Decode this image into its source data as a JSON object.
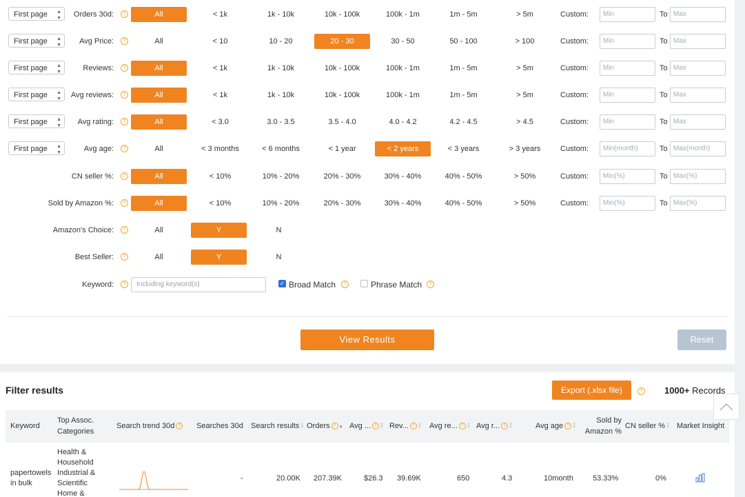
{
  "filters": {
    "select_label": "First page",
    "custom_label": "Custom:",
    "to_label": "To",
    "rows": [
      {
        "label": "Orders 30d:",
        "has_select": true,
        "options": [
          "All",
          "< 1k",
          "1k - 10k",
          "10k - 100k",
          "100k - 1m",
          "1m - 5m",
          "> 5m"
        ],
        "selected": 0,
        "min_placeholder": "Min",
        "max_placeholder": "Max"
      },
      {
        "label": "Avg Price:",
        "has_select": true,
        "options": [
          "All",
          "< 10",
          "10 - 20",
          "20 - 30",
          "30 - 50",
          "50 - 100",
          "> 100"
        ],
        "selected": 3,
        "min_placeholder": "Min",
        "max_placeholder": "Max"
      },
      {
        "label": "Reviews:",
        "has_select": true,
        "options": [
          "All",
          "< 1k",
          "1k - 10k",
          "10k - 100k",
          "100k - 1m",
          "1m - 5m",
          "> 5m"
        ],
        "selected": 0,
        "min_placeholder": "Min",
        "max_placeholder": "Max"
      },
      {
        "label": "Avg reviews:",
        "has_select": true,
        "options": [
          "All",
          "< 1k",
          "1k - 10k",
          "10k - 100k",
          "100k - 1m",
          "1m - 5m",
          "> 5m"
        ],
        "selected": 0,
        "min_placeholder": "Min",
        "max_placeholder": "Max"
      },
      {
        "label": "Avg rating:",
        "has_select": true,
        "options": [
          "All",
          "< 3.0",
          "3.0 - 3.5",
          "3.5 - 4.0",
          "4.0 - 4.2",
          "4.2 - 4.5",
          "> 4.5"
        ],
        "selected": 0,
        "min_placeholder": "Min",
        "max_placeholder": "Max"
      },
      {
        "label": "Avg age:",
        "has_select": true,
        "options": [
          "All",
          "< 3 months",
          "< 6 months",
          "< 1 year",
          "< 2 years",
          "< 3 years",
          "> 3 years"
        ],
        "selected": 4,
        "min_placeholder": "Min(month)",
        "max_placeholder": "Max(month)"
      },
      {
        "label": "CN seller %:",
        "has_select": false,
        "options": [
          "All",
          "< 10%",
          "10% - 20%",
          "20% - 30%",
          "30% - 40%",
          "40% - 50%",
          "> 50%"
        ],
        "selected": 0,
        "min_placeholder": "Min(%)",
        "max_placeholder": "Max(%)"
      },
      {
        "label": "Sold by Amazon %:",
        "has_select": false,
        "options": [
          "All",
          "< 10%",
          "10% - 20%",
          "20% - 30%",
          "30% - 40%",
          "40% - 50%",
          "> 50%"
        ],
        "selected": 0,
        "min_placeholder": "Min(%)",
        "max_placeholder": "Max(%)"
      },
      {
        "label": "Amazon's Choice:",
        "has_select": false,
        "options": [
          "All",
          "Y",
          "N"
        ],
        "selected": 1
      },
      {
        "label": "Best Seller:",
        "has_select": false,
        "options": [
          "All",
          "Y",
          "N"
        ],
        "selected": 1
      }
    ],
    "keyword": {
      "label": "Keyword:",
      "placeholder": "Including keyword(s)",
      "broad_match": "Broad Match",
      "broad_checked": true,
      "phrase_match": "Phrase Match",
      "phrase_checked": false
    },
    "view_results": "View Results",
    "reset": "Reset"
  },
  "results": {
    "title": "Filter results",
    "export_label": "Export (.xlsx file)",
    "count": "1000+",
    "count_suffix": "Records",
    "columns": {
      "keyword": "Keyword",
      "categories": "Top Assoc. Categories",
      "trend": "Search trend 30d",
      "searches": "Searches 30d",
      "search_results": "Search results",
      "orders": "Orders",
      "avg_price": "Avg ...",
      "revenue": "Rev...",
      "avg_reviews": "Avg re...",
      "avg_rating": "Avg r...",
      "avg_age": "Avg age",
      "sold_by_amazon": "Sold by Amazon %",
      "cn_seller": "CN seller %",
      "market_insight": "Market Insight"
    },
    "rows": [
      {
        "keyword": "papertowels in bulk",
        "categories": "Health & Household Industrial & Scientific Home &",
        "searches": "-",
        "search_results": "20.00K",
        "orders": "207.39K",
        "avg_price": "$26.3",
        "revenue": "39.69K",
        "avg_reviews": "650",
        "avg_rating": "4.3",
        "avg_age": "10month",
        "sold_by_amazon": "53.33%",
        "cn_seller": "0%"
      }
    ]
  },
  "colors": {
    "accent": "#f08421",
    "reset_disabled": "#b7c4d4",
    "checkbox": "#2f6fd8"
  }
}
